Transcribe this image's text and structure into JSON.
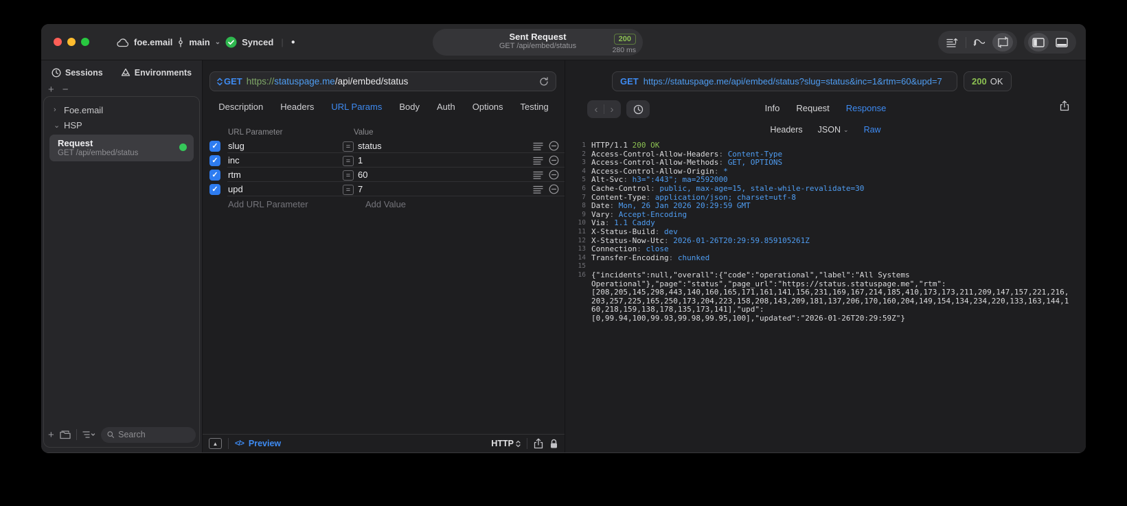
{
  "icons": {
    "chev_right": "›",
    "chev_down": "⌄",
    "back": "‹",
    "forward": "›",
    "dot": "●",
    "check": "✓",
    "equals": "=",
    "triangle_up": "▲",
    "code": "</>"
  },
  "titlebar": {
    "project": "foe.email",
    "branch": "main",
    "sync_status": "Synced",
    "center": {
      "title": "Sent Request",
      "subtitle": "GET /api/embed/status",
      "status_code": "200",
      "duration": "280 ms"
    }
  },
  "sidebar": {
    "tabs": {
      "sessions": "Sessions",
      "environments": "Environments"
    },
    "tree": {
      "group1": "Foe.email",
      "group2": "HSP"
    },
    "request_item": {
      "title": "Request",
      "subtitle": "GET /api/embed/status"
    },
    "search_placeholder": "Search"
  },
  "request_pane": {
    "method": "GET",
    "url_parts": {
      "scheme": "https://",
      "host": "statuspage.me",
      "path": "/api/embed/status"
    },
    "tabs": [
      "Description",
      "Headers",
      "URL Params",
      "Body",
      "Auth",
      "Options",
      "Testing"
    ],
    "active_tab": "URL Params",
    "table": {
      "columns": [
        "URL Parameter",
        "Value"
      ],
      "rows": [
        {
          "name": "slug",
          "value": "status",
          "checked": true
        },
        {
          "name": "inc",
          "value": "1",
          "checked": true
        },
        {
          "name": "rtm",
          "value": "60",
          "checked": true
        },
        {
          "name": "upd",
          "value": "7",
          "checked": true
        }
      ],
      "add_name_placeholder": "Add URL Parameter",
      "add_value_placeholder": "Add Value"
    },
    "footer": {
      "preview_label": "Preview",
      "protocol": "HTTP"
    }
  },
  "response_pane": {
    "method": "GET",
    "url": "https://statuspage.me/api/embed/status?slug=status&inc=1&rtm=60&upd=7",
    "status_code": "200",
    "status_text": "OK",
    "tabs": [
      "Info",
      "Request",
      "Response"
    ],
    "active_tab": "Response",
    "subtabs": [
      {
        "label": "Headers"
      },
      {
        "label": "JSON",
        "chevron": true
      },
      {
        "label": "Raw"
      }
    ],
    "active_subtab": "Raw",
    "body_lines": [
      {
        "n": "1",
        "parts": [
          [
            "HTTP/1.1 ",
            "w"
          ],
          [
            "200 OK",
            "grn"
          ]
        ]
      },
      {
        "n": "2",
        "parts": [
          [
            "Access-Control-Allow-Headers",
            "w"
          ],
          [
            ": ",
            "g"
          ],
          [
            "Content-Type",
            "b"
          ]
        ]
      },
      {
        "n": "3",
        "parts": [
          [
            "Access-Control-Allow-Methods",
            "w"
          ],
          [
            ": ",
            "g"
          ],
          [
            "GET, OPTIONS",
            "b"
          ]
        ]
      },
      {
        "n": "4",
        "parts": [
          [
            "Access-Control-Allow-Origin",
            "w"
          ],
          [
            ": ",
            "g"
          ],
          [
            "*",
            "b"
          ]
        ]
      },
      {
        "n": "5",
        "parts": [
          [
            "Alt-Svc",
            "w"
          ],
          [
            ": ",
            "g"
          ],
          [
            "h3=\":443\"; ma=2592000",
            "b"
          ]
        ]
      },
      {
        "n": "6",
        "parts": [
          [
            "Cache-Control",
            "w"
          ],
          [
            ": ",
            "g"
          ],
          [
            "public, max-age=15, stale-while-revalidate=30",
            "b"
          ]
        ]
      },
      {
        "n": "7",
        "parts": [
          [
            "Content-Type",
            "w"
          ],
          [
            ": ",
            "g"
          ],
          [
            "application/json; charset=utf-8",
            "b"
          ]
        ]
      },
      {
        "n": "8",
        "parts": [
          [
            "Date",
            "w"
          ],
          [
            ": ",
            "g"
          ],
          [
            "Mon, 26 Jan 2026 20:29:59 GMT",
            "b"
          ]
        ]
      },
      {
        "n": "9",
        "parts": [
          [
            "Vary",
            "w"
          ],
          [
            ": ",
            "g"
          ],
          [
            "Accept-Encoding",
            "b"
          ]
        ]
      },
      {
        "n": "10",
        "parts": [
          [
            "Via",
            "w"
          ],
          [
            ": ",
            "g"
          ],
          [
            "1.1 Caddy",
            "b"
          ]
        ]
      },
      {
        "n": "11",
        "parts": [
          [
            "X-Status-Build",
            "w"
          ],
          [
            ": ",
            "g"
          ],
          [
            "dev",
            "b"
          ]
        ]
      },
      {
        "n": "12",
        "parts": [
          [
            "X-Status-Now-Utc",
            "w"
          ],
          [
            ": ",
            "g"
          ],
          [
            "2026-01-26T20:29:59.859105261Z",
            "b"
          ]
        ]
      },
      {
        "n": "13",
        "parts": [
          [
            "Connection",
            "w"
          ],
          [
            ": ",
            "g"
          ],
          [
            "close",
            "b"
          ]
        ]
      },
      {
        "n": "14",
        "parts": [
          [
            "Transfer-Encoding",
            "w"
          ],
          [
            ": ",
            "g"
          ],
          [
            "chunked",
            "b"
          ]
        ]
      },
      {
        "n": "15",
        "parts": []
      },
      {
        "n": "16",
        "parts": [
          [
            "{\"incidents\":null,\"overall\":{\"code\":\"operational\",\"label\":\"All Systems",
            "w"
          ]
        ]
      },
      {
        "n": "",
        "parts": [
          [
            "Operational\"},\"page\":\"status\",\"page_url\":\"https://status.statuspage.me\",\"rtm\":",
            "w"
          ]
        ]
      },
      {
        "n": "",
        "parts": [
          [
            "[208,205,145,298,443,140,160,165,171,161,141,156,231,169,167,214,185,410,173,173,211,209,147,157,221,216,",
            "w"
          ]
        ]
      },
      {
        "n": "",
        "parts": [
          [
            "203,257,225,165,250,173,204,223,158,208,143,209,181,137,206,170,160,204,149,154,134,234,220,133,163,144,1",
            "w"
          ]
        ]
      },
      {
        "n": "",
        "parts": [
          [
            "60,218,159,138,178,135,173,141],\"upd\":",
            "w"
          ]
        ]
      },
      {
        "n": "",
        "parts": [
          [
            "[0,99.94,100,99.93,99.98,99.95,100],\"updated\":\"2026-01-26T20:29:59Z\"}",
            "w"
          ]
        ]
      }
    ],
    "colors": {
      "accent_blue": "#3e8bf2",
      "code_blue": "#4f9df2",
      "status_green": "#8cc152",
      "dot_green": "#35c759"
    }
  }
}
